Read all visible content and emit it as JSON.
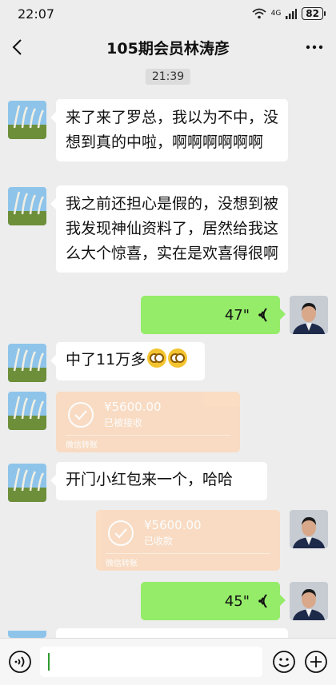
{
  "status_bar": {
    "time": "22:07",
    "signal": "4G",
    "battery": "82"
  },
  "nav": {
    "title": "105期会员林涛彦"
  },
  "timestamp": "21:39",
  "messages": {
    "m1": {
      "text": "来了来了罗总，我以为不中，没想到真的中啦，啊啊啊啊啊啊"
    },
    "m2": {
      "text": "我之前还担心是假的，没想到被我发现神仙资料了，居然给我这么大个惊喜，实在是欢喜得很啊"
    },
    "v1": {
      "duration": "47\""
    },
    "m3": {
      "text": "中了11万多"
    },
    "t1": {
      "amount": "¥5600.00",
      "status": "已被接收",
      "footer": "微信转账"
    },
    "m4": {
      "text": "开门小红包来一个，哈哈"
    },
    "t2": {
      "amount": "¥5600.00",
      "status": "已收款",
      "footer": "微信转账"
    },
    "v2": {
      "duration": "45\""
    }
  },
  "colors": {
    "background": "#ededed",
    "voice_bubble": "#95ec69",
    "transfer_card": "#fbd9bb"
  },
  "icons": [
    "back-icon",
    "more-icon",
    "voice-input-icon",
    "emoji-icon",
    "add-icon",
    "wifi-icon",
    "check-circle-icon"
  ]
}
